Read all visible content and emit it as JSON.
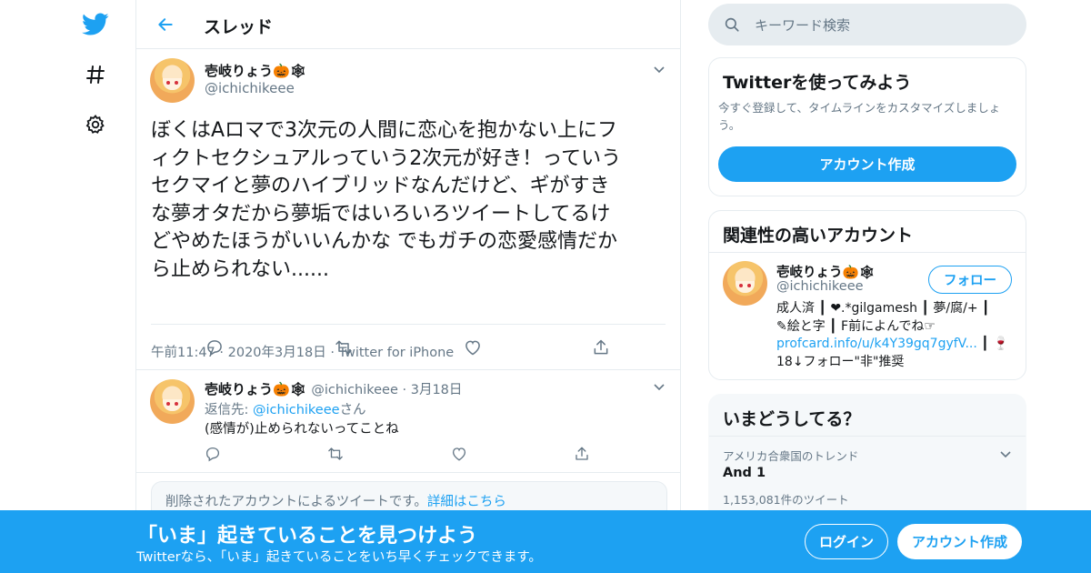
{
  "header": {
    "title": "スレッド"
  },
  "main_tweet": {
    "name": "壱岐りょう🎃🕸",
    "handle": "@ichichikeee",
    "text": "ぼくはAロマで3次元の人間に恋心を抱かない上にフ\nィクトセクシュアルっていう2次元が好き！っていう\nセクマイと夢のハイブリッドなんだけど、ギがすき\nな夢オタだから夢垢ではいろいろツイートしてるけ\nどやめたほうがいいんかな でもガチの恋愛感情だか\nら止められない......",
    "time": "午前11:47",
    "date": "2020年3月18日",
    "client": "Twitter for iPhone",
    "sep": "·"
  },
  "reply": {
    "name": "壱岐りょう🎃🕸",
    "handle": "@ichichikeee",
    "sep": "·",
    "date": "3月18日",
    "reply_to_prefix": "返信先: ",
    "reply_to_handle": "@ichichikeee",
    "reply_to_suffix": "さん",
    "text": "(感情が)止められないってことね"
  },
  "deleted_notice": {
    "text": "削除されたアカウントによるツイートです。",
    "link": "詳細はこちら"
  },
  "search": {
    "placeholder": "キーワード検索"
  },
  "signup_card": {
    "title": "Twitterを使ってみよう",
    "desc": "今すぐ登録して、タイムラインをカスタマイズしましょう。",
    "button": "アカウント作成"
  },
  "related_card": {
    "title": "関連性の高いアカウント",
    "name": "壱岐りょう🎃🕸",
    "handle": "@ichichikeee",
    "follow": "フォロー",
    "bio_line1": "成人済 ┃ ❤︎.*gilgamesh ┃ 夢/腐/+ ┃",
    "bio_line2": "✎︎絵と字 ┃ F前によんでね☞",
    "bio_link": "profcard.info/u/k4Y39gq7gyfV...",
    "bio_line3_suffix": " ┃ 🍷",
    "bio_line4": "18↓フォロー\"非\"推奨"
  },
  "trends_card": {
    "title": "いまどうしてる？",
    "location": "アメリカ合衆国のトレンド",
    "topic": "And 1",
    "count": "1,153,081件のツイート"
  },
  "bottom_bar": {
    "title": "「いま」起きていることを見つけよう",
    "subtitle": "Twitterなら、「いま」起きていることをいち早くチェックできます。",
    "login": "ログイン",
    "signup": "アカウント作成"
  },
  "colors": {
    "accent": "#1da1f2",
    "secondary_text": "#657786",
    "border": "#e6ecf0"
  },
  "icons": [
    "twitter-bird-icon",
    "hashtag-icon",
    "gear-icon",
    "back-arrow-icon",
    "chevron-down-icon",
    "reply-icon",
    "retweet-icon",
    "like-icon",
    "share-icon",
    "search-icon"
  ]
}
